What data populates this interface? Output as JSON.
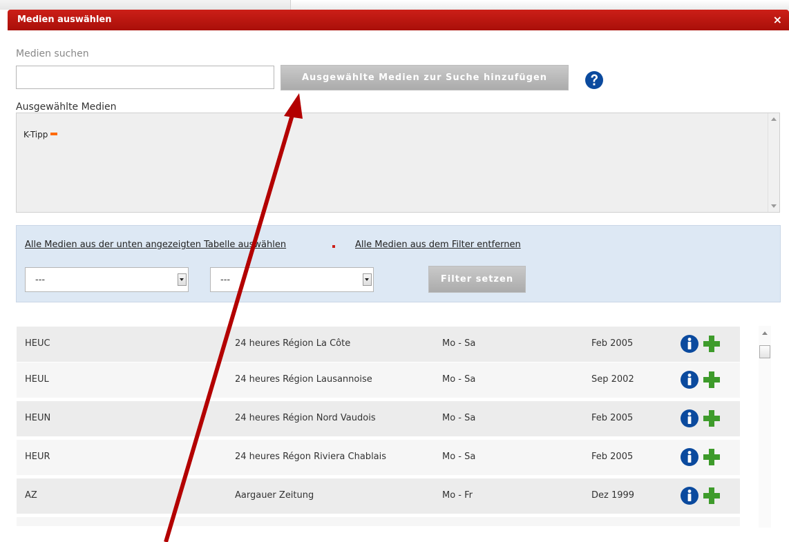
{
  "dialog": {
    "title": "Medien auswählen",
    "close_glyph": "×"
  },
  "search": {
    "label": "Medien suchen",
    "value": "",
    "placeholder": "",
    "add_button_label": "Ausgewählte Medien zur Suche hinzufügen"
  },
  "selected": {
    "label": "Ausgewählte Medien",
    "items": [
      "K-Tipp"
    ]
  },
  "filter": {
    "link_select_all": "Alle Medien aus der unten angezeigten Tabelle auswählen",
    "link_remove_all": "Alle Medien aus dem Filter entfernen",
    "select1_value": "---",
    "select2_value": "---",
    "button_label": "Filter setzen"
  },
  "media_list": {
    "rows": [
      {
        "code": "HEUC",
        "name": "24 heures Région La Côte",
        "days": "Mo - Sa",
        "since": "Feb 2005"
      },
      {
        "code": "HEUL",
        "name": "24 heures Région Lausannoise",
        "days": "Mo - Sa",
        "since": "Sep 2002"
      },
      {
        "code": "HEUN",
        "name": "24 heures Région Nord Vaudois",
        "days": "Mo - Sa",
        "since": "Feb 2005"
      },
      {
        "code": "HEUR",
        "name": "24 heures Régon Riviera Chablais",
        "days": "Mo - Sa",
        "since": "Feb 2005"
      },
      {
        "code": "AZ",
        "name": "Aargauer Zeitung",
        "days": "Mo - Fr",
        "since": "Dez 1999"
      },
      {
        "code": "",
        "name": "",
        "days": "",
        "since": ""
      }
    ]
  },
  "colors": {
    "titlebar": "#b8140d",
    "row_odd": "#ececec",
    "row_even": "#f6f6f6",
    "info_icon": "#0b4a9e",
    "plus_icon": "#3e9b2b",
    "annotation_arrow": "#b30000"
  },
  "icons": {
    "help": "help-question-icon",
    "info": "info-icon",
    "add": "plus-icon",
    "remove": "minus-icon",
    "close": "close-icon"
  }
}
